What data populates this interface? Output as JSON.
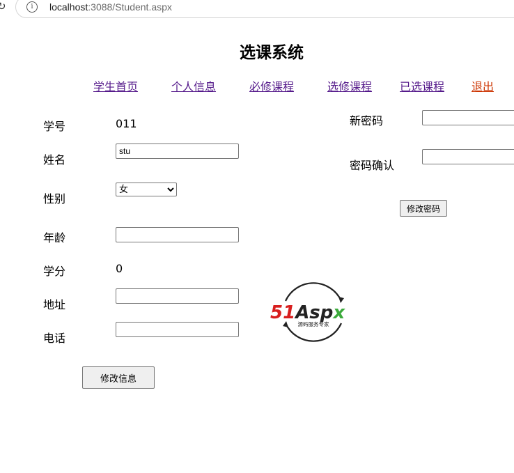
{
  "browser": {
    "url_host": "localhost",
    "url_rest": ":3088/Student.aspx",
    "info_icon": "i"
  },
  "page": {
    "title": "选课系统"
  },
  "nav": {
    "items": [
      "学生首页",
      "个人信息",
      "必修课程",
      "选修课程",
      "已选课程"
    ],
    "exit": "退出"
  },
  "form": {
    "student_id_label": "学号",
    "student_id_value": "011",
    "name_label": "姓名",
    "name_value": "stu",
    "gender_label": "性别",
    "gender_value": "女",
    "age_label": "年龄",
    "age_value": "",
    "credits_label": "学分",
    "credits_value": "0",
    "address_label": "地址",
    "address_value": "",
    "phone_label": "电话",
    "phone_value": "",
    "submit_label": "修改信息"
  },
  "password": {
    "new_label": "新密码",
    "confirm_label": "密码确认",
    "new_value": "",
    "confirm_value": "",
    "submit_label": "修改密码"
  },
  "logo": {
    "brand": "51Aspx",
    "tagline": "源码服务专家",
    "colors": {
      "red": "#d81e1e",
      "dark": "#222222",
      "green": "#3caa3c"
    }
  }
}
